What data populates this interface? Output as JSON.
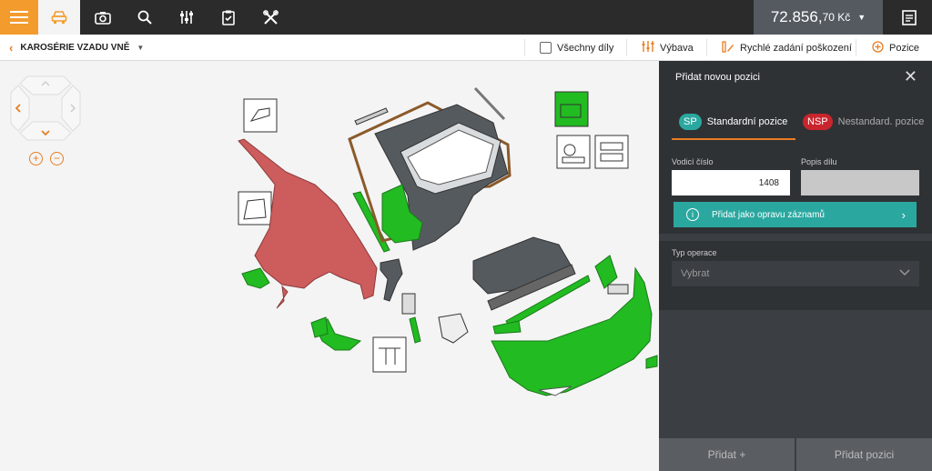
{
  "topbar": {
    "icons": [
      "menu-icon",
      "car-icon",
      "camera-icon",
      "search-icon",
      "sliders-icon",
      "clipboard-icon",
      "tools-icon",
      "receipt-icon"
    ],
    "price_main": "72.856,",
    "price_decimal": "70 Kč",
    "accent": "#f39c2d"
  },
  "subbar": {
    "breadcrumb": "KAROSÉRIE VZADU VNĚ",
    "all_parts": "Všechny díly",
    "equipment": "Výbava",
    "quick_damage": "Rychlé zadání poškození",
    "positions": "Pozice"
  },
  "panel": {
    "title": "Přidat novou pozici",
    "tab_standard_badge": "SP",
    "tab_standard": "Standardní pozice",
    "tab_nonstandard_badge": "NSP",
    "tab_nonstandard": "Nestandard. pozice",
    "label_vodici": "Vodicí číslo",
    "value_vodici": "1408",
    "label_popis": "Popis dílu",
    "value_popis": "",
    "repair_button": "Přidat jako opravu záznamů",
    "label_operation": "Typ operace",
    "operation_placeholder": "Vybrat",
    "add_plus": "Přidat +",
    "add_position": "Přidat pozici"
  },
  "colors": {
    "teal": "#2aa8a0",
    "red_badge": "#c9252d",
    "part_green": "#22bb22",
    "part_red": "#cd5c5c",
    "part_gray": "#555a5f"
  }
}
